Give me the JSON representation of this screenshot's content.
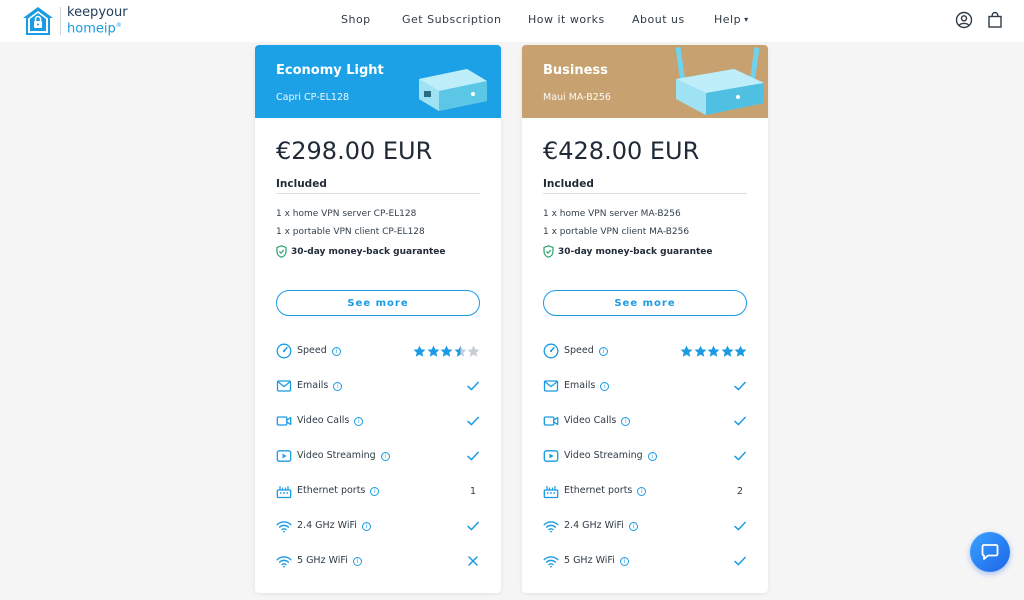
{
  "header": {
    "logo": {
      "line1": "keepyour",
      "line2": "homeip",
      "mark": "®"
    },
    "nav": [
      {
        "label": "Shop"
      },
      {
        "label": "Get Subscription"
      },
      {
        "label": "How it works"
      },
      {
        "label": "About us"
      },
      {
        "label": "Help"
      }
    ],
    "icons": [
      "account-icon",
      "shopping-bag-icon"
    ]
  },
  "colors": {
    "accent": "#1a9be3",
    "economy_header": "#1da1e6",
    "business_header": "#c7a270",
    "chat": "#2b7cf0"
  },
  "plans": [
    {
      "title": "Economy Light",
      "model": "Capri CP-EL128",
      "price": "€298.00 EUR",
      "included_label": "Included",
      "included": [
        "1 x home VPN server CP-EL128",
        "1 x portable VPN client CP-EL128"
      ],
      "guarantee": "30-day money-back guarantee",
      "see_more": "See more",
      "features": [
        {
          "label": "Speed",
          "icon": "speedometer-icon",
          "rating": 3.5,
          "rating_max": 5
        },
        {
          "label": "Emails",
          "icon": "email-icon",
          "value": "check"
        },
        {
          "label": "Video Calls",
          "icon": "video-camera-icon",
          "value": "check"
        },
        {
          "label": "Video Streaming",
          "icon": "play-icon",
          "value": "check"
        },
        {
          "label": "Ethernet ports",
          "icon": "ethernet-icon",
          "value": "1"
        },
        {
          "label": "2.4 GHz WiFi",
          "icon": "wifi-icon",
          "value": "check"
        },
        {
          "label": "5 GHz WiFi",
          "icon": "wifi-icon",
          "value": "cross"
        }
      ]
    },
    {
      "title": "Business",
      "model": "Maui MA-B256",
      "price": "€428.00 EUR",
      "included_label": "Included",
      "included": [
        "1 x home VPN server MA-B256",
        "1 x portable VPN client MA-B256"
      ],
      "guarantee": "30-day money-back guarantee",
      "see_more": "See more",
      "features": [
        {
          "label": "Speed",
          "icon": "speedometer-icon",
          "rating": 5,
          "rating_max": 5
        },
        {
          "label": "Emails",
          "icon": "email-icon",
          "value": "check"
        },
        {
          "label": "Video Calls",
          "icon": "video-camera-icon",
          "value": "check"
        },
        {
          "label": "Video Streaming",
          "icon": "play-icon",
          "value": "check"
        },
        {
          "label": "Ethernet ports",
          "icon": "ethernet-icon",
          "value": "2"
        },
        {
          "label": "2.4 GHz WiFi",
          "icon": "wifi-icon",
          "value": "check"
        },
        {
          "label": "5 GHz WiFi",
          "icon": "wifi-icon",
          "value": "check"
        }
      ]
    }
  ],
  "chat": {
    "icon": "chat-bubble-icon"
  }
}
